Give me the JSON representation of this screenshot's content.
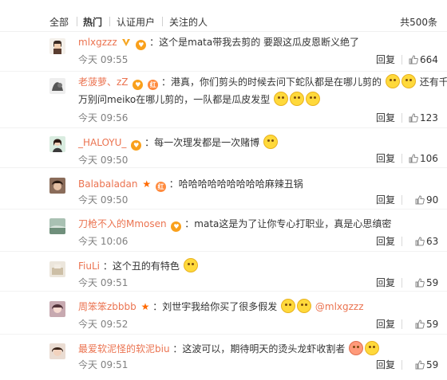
{
  "tabs": {
    "all": "全部",
    "hot": "热门",
    "verified": "认证用户",
    "following": "关注的人",
    "total": "共500条"
  },
  "labels": {
    "reply": "回复"
  },
  "colors": {
    "username": "#eb7350",
    "badge": "#f9a01c",
    "star": "#ff6a00"
  },
  "comments": [
    {
      "user": "mlxgzzz",
      "text": "：这个是mata带我去剪的 要跟这瓜皮恩断义绝了",
      "time": "今天 09:55",
      "likes": "664"
    },
    {
      "user": "老菠萝、zZ",
      "text1": "：港真，你们剪头的时候去问下蛇队都是在哪儿剪的",
      "text1b": "还有千",
      "text2": "万别问meiko在哪儿剪的，一队都是瓜皮发型",
      "time": "今天 09:56",
      "likes": "123"
    },
    {
      "user": "_HALOYU_",
      "text": "：每一次理发都是一次赌博",
      "time": "今天 09:50",
      "likes": "106"
    },
    {
      "user": "Balabaladan",
      "text": "：哈哈哈哈哈哈哈哈哈麻辣丑锅",
      "time": "今天 09:50",
      "likes": "90"
    },
    {
      "user": "刀枪不入的Mmosen",
      "text": "：mata这是为了让你专心打职业，真是心思缜密",
      "time": "今天 10:06",
      "likes": "63"
    },
    {
      "user": "FiuLi",
      "text": "：这个丑的有特色",
      "time": "今天 09:51",
      "likes": "59"
    },
    {
      "user": "周笨笨zbbbb",
      "text": "：刘世宇我给你买了很多假发",
      "mention": "@mlxgzzz",
      "time": "今天 09:52",
      "likes": "59"
    },
    {
      "user": "最爱软泥怪的软泥biu",
      "text": "：这波可以，期待明天的烫头龙虾收割者",
      "time": "今天 09:51",
      "likes": "59"
    }
  ]
}
